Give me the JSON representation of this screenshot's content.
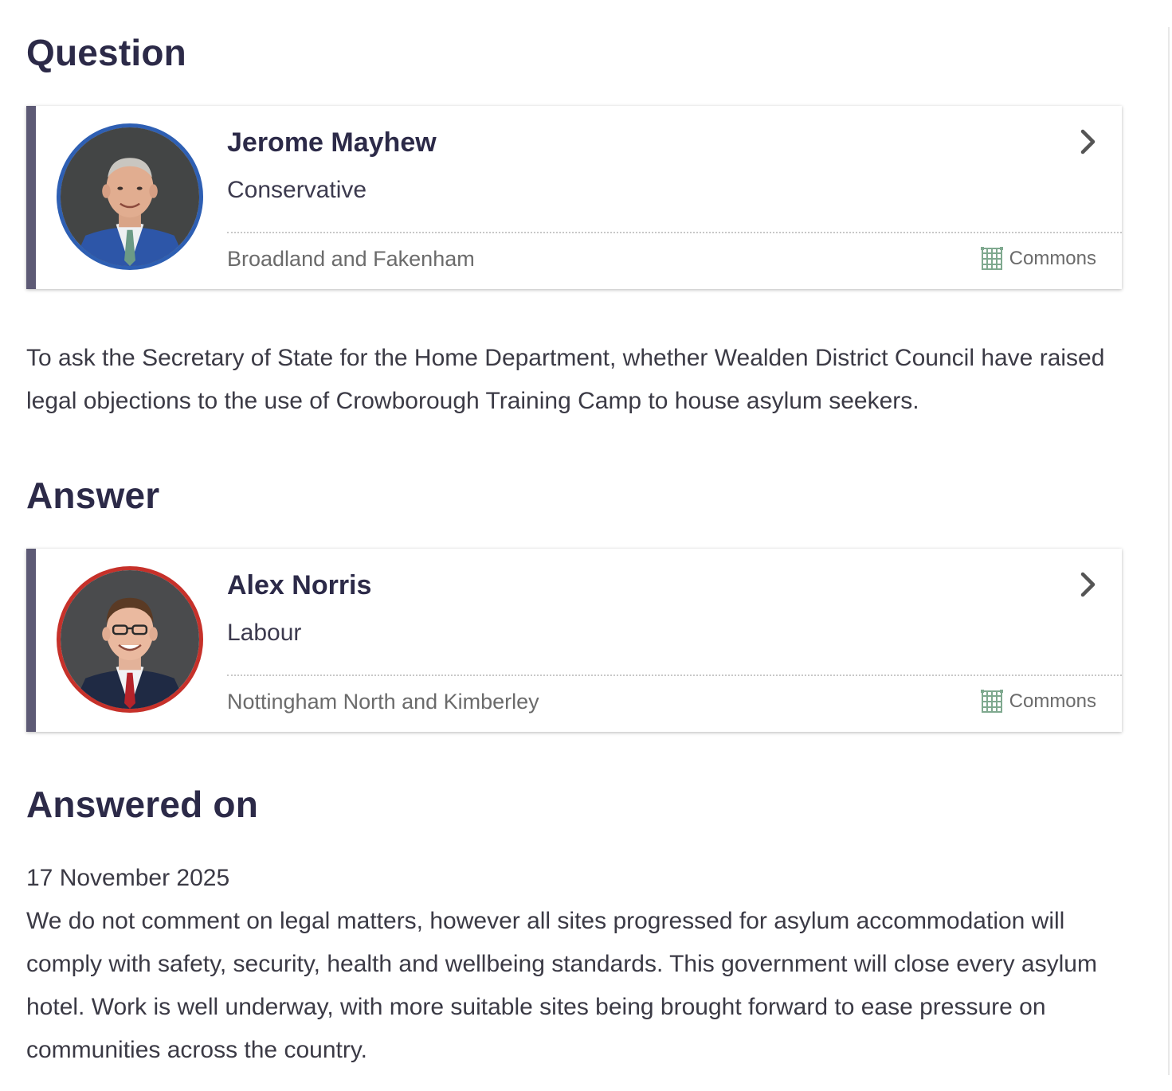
{
  "question": {
    "heading": "Question",
    "member": {
      "name": "Jerome Mayhew",
      "party": "Conservative",
      "constituency": "Broadland and Fakenham",
      "house": "Commons",
      "party_color": "#2e5fb3"
    },
    "text": "To ask the Secretary of State for the Home Department, whether Wealden District Council have raised legal objections to the use of Crowborough Training Camp to house asylum seekers."
  },
  "answer": {
    "heading": "Answer",
    "member": {
      "name": "Alex Norris",
      "party": "Labour",
      "constituency": "Nottingham North and Kimberley",
      "house": "Commons",
      "party_color": "#c6312a"
    }
  },
  "answered_on": {
    "heading": "Answered on",
    "date": "17 November 2025",
    "text": "We do not comment on legal matters, however all sites progressed for asylum accommodation will comply with safety, security, health and wellbeing standards. This government will close every asylum hotel. Work is well underway, with more suitable sites being brought forward to ease pressure on communities across the country."
  },
  "icons": {
    "chevron": "chevron-right-icon",
    "house": "portcullis-icon"
  },
  "colors": {
    "heading": "#2c2a48",
    "card_bar": "#5d5a75",
    "commons_green": "#7fa98f"
  }
}
